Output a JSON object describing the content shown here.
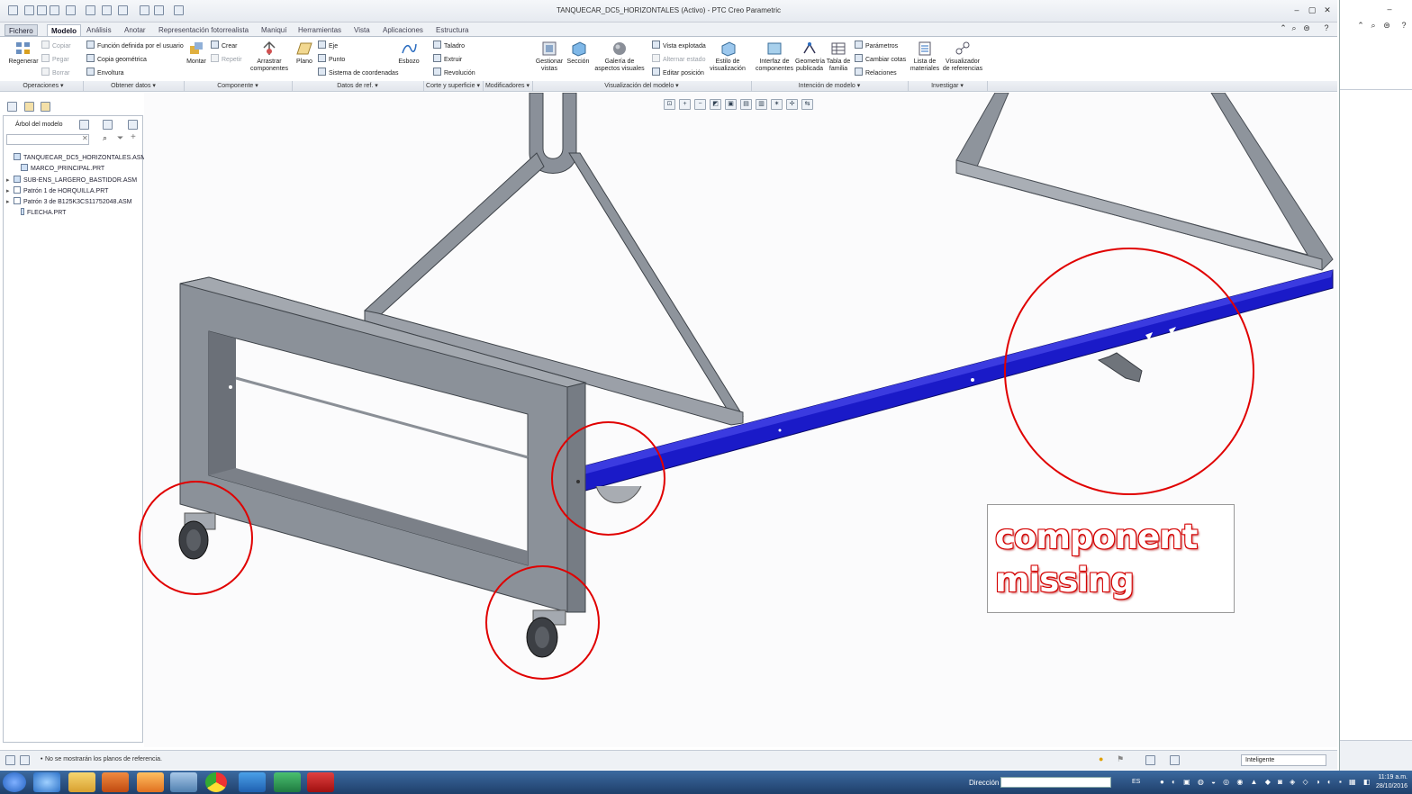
{
  "window": {
    "title": "TANQUECAR_DC5_HORIZONTALES (Activo) - PTC Creo Parametric"
  },
  "tabs": [
    {
      "label": "Fichero"
    },
    {
      "label": "Modelo"
    },
    {
      "label": "Análisis"
    },
    {
      "label": "Anotar"
    },
    {
      "label": "Representación fotorrealista"
    },
    {
      "label": "Maniquí"
    },
    {
      "label": "Herramientas"
    },
    {
      "label": "Vista"
    },
    {
      "label": "Aplicaciones"
    },
    {
      "label": "Estructura"
    }
  ],
  "ribbon": {
    "regenerar": "Regenerar",
    "copiar": "Copiar",
    "pegar": "Pegar",
    "borrar": "Borrar",
    "funcion_usuario": "Función definida por el usuario",
    "copia_geometrica": "Copia geométrica",
    "envoltura": "Envoltura",
    "montar": "Montar",
    "crear": "Crear",
    "repetir": "Repetir",
    "arrastrar": "Arrastrar componentes",
    "plano": "Plano",
    "eje": "Eje",
    "punto": "Punto",
    "sistema_coord": "Sistema de coordenadas",
    "esbozo": "Esbozo",
    "taladro": "Taladro",
    "extruir": "Extruir",
    "revolucion": "Revolución",
    "gestionar_vistas": "Gestionar vistas",
    "seccion": "Sección",
    "galeria": "Galería de aspectos visuales",
    "vista_explotada": "Vista explotada",
    "alternar_estado": "Alternar estado",
    "editar_posicion": "Editar posición",
    "estilo_visualizacion": "Estilo de visualización",
    "interfaz_componentes": "Interfaz de componentes",
    "geometria_publicada": "Geometría publicada",
    "tabla_familia": "Tabla de familia",
    "parametros": "Parámetros",
    "cambiar_cotas": "Cambiar cotas",
    "relaciones": "Relaciones",
    "lista_materiales": "Lista de materiales",
    "visualizador_referencias": "Visualizador de referencias"
  },
  "groups": [
    {
      "label": "Operaciones"
    },
    {
      "label": "Obtener datos"
    },
    {
      "label": "Componente"
    },
    {
      "label": "Datos de ref."
    },
    {
      "label": "Corte y superficie"
    },
    {
      "label": "Modificadores"
    },
    {
      "label": "Visualización del modelo"
    },
    {
      "label": "Intención de modelo"
    },
    {
      "label": "Investigar"
    }
  ],
  "tree": {
    "header": "Árbol del modelo",
    "items": [
      {
        "label": "TANQUECAR_DC5_HORIZONTALES.ASM",
        "expander": ""
      },
      {
        "label": "MARCO_PRINCIPAL.PRT",
        "expander": ""
      },
      {
        "label": "SUB-ENS_LARGERO_BASTIDOR.ASM",
        "expander": "▸"
      },
      {
        "label": "Patrón 1 de HORQUILLA.PRT",
        "expander": "▸"
      },
      {
        "label": "Patrón 3 de B125K3CS11752048.ASM",
        "expander": "▸"
      },
      {
        "label": "FLECHA.PRT",
        "expander": ""
      }
    ]
  },
  "status": {
    "message": "No se mostrarán los planos de referencia.",
    "filter": "Inteligente"
  },
  "annotation": {
    "line1": "component",
    "line2": "missing"
  },
  "taskbar": {
    "address_label": "Dirección",
    "lang": "ES",
    "time": "11:19 a.m.",
    "date": "28/10/2016"
  },
  "colors": {
    "beam_blue": "#1a1ac8",
    "frame_gray": "#8a9099",
    "annotation_red": "#e00000"
  }
}
